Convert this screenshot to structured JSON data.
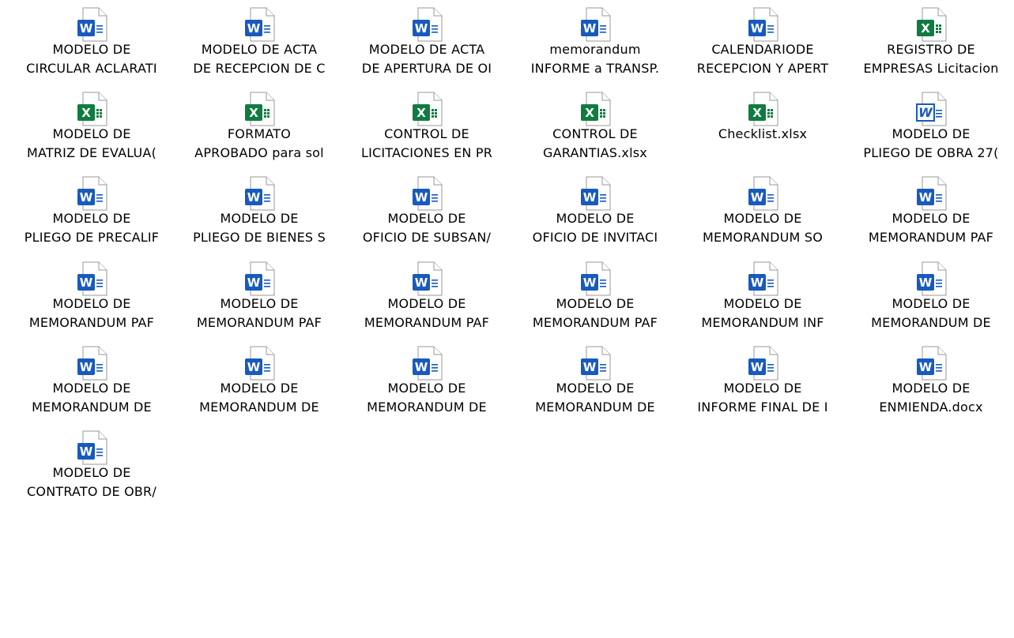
{
  "desktop": {
    "files": [
      {
        "row": 0,
        "col": 0,
        "type": "word",
        "line1": "MODELO DE",
        "line2": "CIRCULAR ACLARATI"
      },
      {
        "row": 0,
        "col": 1,
        "type": "word",
        "line1": "MODELO DE ACTA",
        "line2": "DE RECEPCION DE C"
      },
      {
        "row": 0,
        "col": 2,
        "type": "word",
        "line1": "MODELO DE ACTA",
        "line2": "DE APERTURA DE OI"
      },
      {
        "row": 0,
        "col": 3,
        "type": "word",
        "line1": "memorandum",
        "line2": "INFORME a TRANSP."
      },
      {
        "row": 0,
        "col": 4,
        "type": "word",
        "line1": "CALENDARIODE",
        "line2": "RECEPCION Y APERT"
      },
      {
        "row": 0,
        "col": 5,
        "type": "excel",
        "line1": "REGISTRO DE",
        "line2": "EMPRESAS Licitacion"
      },
      {
        "row": 1,
        "col": 0,
        "type": "excel",
        "line1": "MODELO DE",
        "line2": "MATRIZ DE EVALUA("
      },
      {
        "row": 1,
        "col": 1,
        "type": "excel",
        "line1": "FORMATO",
        "line2": "APROBADO para sol"
      },
      {
        "row": 1,
        "col": 2,
        "type": "excel",
        "line1": "CONTROL DE",
        "line2": "LICITACIONES EN PR"
      },
      {
        "row": 1,
        "col": 3,
        "type": "excel",
        "line1": "CONTROL DE",
        "line2": "GARANTIAS.xlsx"
      },
      {
        "row": 1,
        "col": 4,
        "type": "excel",
        "line1": "Checklist.xlsx",
        "line2": ""
      },
      {
        "row": 1,
        "col": 5,
        "type": "word-old",
        "line1": "MODELO DE",
        "line2": "PLIEGO DE OBRA 27("
      },
      {
        "row": 2,
        "col": 0,
        "type": "word",
        "line1": "MODELO DE",
        "line2": "PLIEGO DE PRECALIF"
      },
      {
        "row": 2,
        "col": 1,
        "type": "word",
        "line1": "MODELO DE",
        "line2": "PLIEGO DE BIENES S"
      },
      {
        "row": 2,
        "col": 2,
        "type": "word",
        "line1": "MODELO DE",
        "line2": "OFICIO DE SUBSAN/"
      },
      {
        "row": 2,
        "col": 3,
        "type": "word",
        "line1": "MODELO DE",
        "line2": "OFICIO DE INVITACI"
      },
      {
        "row": 2,
        "col": 4,
        "type": "word",
        "line1": "MODELO DE",
        "line2": "MEMORANDUM SO"
      },
      {
        "row": 2,
        "col": 5,
        "type": "word",
        "line1": "MODELO DE",
        "line2": "MEMORANDUM PAF"
      },
      {
        "row": 3,
        "col": 0,
        "type": "word",
        "line1": "MODELO DE",
        "line2": "MEMORANDUM PAF"
      },
      {
        "row": 3,
        "col": 1,
        "type": "word",
        "line1": "MODELO DE",
        "line2": "MEMORANDUM PAF"
      },
      {
        "row": 3,
        "col": 2,
        "type": "word",
        "line1": "MODELO DE",
        "line2": "MEMORANDUM PAF"
      },
      {
        "row": 3,
        "col": 3,
        "type": "word",
        "line1": "MODELO DE",
        "line2": "MEMORANDUM PAF"
      },
      {
        "row": 3,
        "col": 4,
        "type": "word",
        "line1": "MODELO DE",
        "line2": "MEMORANDUM INF"
      },
      {
        "row": 3,
        "col": 5,
        "type": "word",
        "line1": "MODELO DE",
        "line2": "MEMORANDUM DE"
      },
      {
        "row": 4,
        "col": 0,
        "type": "word",
        "line1": "MODELO DE",
        "line2": "MEMORANDUM DE"
      },
      {
        "row": 4,
        "col": 1,
        "type": "word",
        "line1": "MODELO DE",
        "line2": "MEMORANDUM DE"
      },
      {
        "row": 4,
        "col": 2,
        "type": "word",
        "line1": "MODELO DE",
        "line2": "MEMORANDUM DE"
      },
      {
        "row": 4,
        "col": 3,
        "type": "word",
        "line1": "MODELO DE",
        "line2": "MEMORANDUM DE"
      },
      {
        "row": 4,
        "col": 4,
        "type": "word",
        "line1": "MODELO DE",
        "line2": "INFORME FINAL DE I"
      },
      {
        "row": 4,
        "col": 5,
        "type": "word",
        "line1": "MODELO DE",
        "line2": "ENMIENDA.docx"
      },
      {
        "row": 5,
        "col": 0,
        "type": "word",
        "line1": "MODELO DE",
        "line2": "CONTRATO DE OBR/"
      }
    ]
  },
  "colors": {
    "word": "#185abd",
    "excel": "#107c41"
  }
}
